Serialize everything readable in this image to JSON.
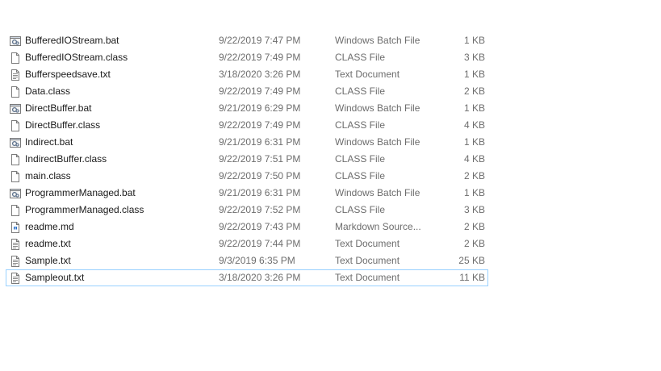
{
  "files": [
    {
      "name": "BufferedIOStream.bat",
      "date": "9/22/2019 7:47 PM",
      "type": "Windows Batch File",
      "size": "1 KB",
      "icon": "batch-file-icon"
    },
    {
      "name": "BufferedIOStream.class",
      "date": "9/22/2019 7:49 PM",
      "type": "CLASS File",
      "size": "3 KB",
      "icon": "generic-file-icon"
    },
    {
      "name": "Bufferspeedsave.txt",
      "date": "3/18/2020 3:26 PM",
      "type": "Text Document",
      "size": "1 KB",
      "icon": "text-file-icon"
    },
    {
      "name": "Data.class",
      "date": "9/22/2019 7:49 PM",
      "type": "CLASS File",
      "size": "2 KB",
      "icon": "generic-file-icon"
    },
    {
      "name": "DirectBuffer.bat",
      "date": "9/21/2019 6:29 PM",
      "type": "Windows Batch File",
      "size": "1 KB",
      "icon": "batch-file-icon"
    },
    {
      "name": "DirectBuffer.class",
      "date": "9/22/2019 7:49 PM",
      "type": "CLASS File",
      "size": "4 KB",
      "icon": "generic-file-icon"
    },
    {
      "name": "Indirect.bat",
      "date": "9/21/2019 6:31 PM",
      "type": "Windows Batch File",
      "size": "1 KB",
      "icon": "batch-file-icon"
    },
    {
      "name": "IndirectBuffer.class",
      "date": "9/22/2019 7:51 PM",
      "type": "CLASS File",
      "size": "4 KB",
      "icon": "generic-file-icon"
    },
    {
      "name": "main.class",
      "date": "9/22/2019 7:50 PM",
      "type": "CLASS File",
      "size": "2 KB",
      "icon": "generic-file-icon"
    },
    {
      "name": "ProgrammerManaged.bat",
      "date": "9/21/2019 6:31 PM",
      "type": "Windows Batch File",
      "size": "1 KB",
      "icon": "batch-file-icon"
    },
    {
      "name": "ProgrammerManaged.class",
      "date": "9/22/2019 7:52 PM",
      "type": "CLASS File",
      "size": "3 KB",
      "icon": "generic-file-icon"
    },
    {
      "name": "readme.md",
      "date": "9/22/2019 7:43 PM",
      "type": "Markdown Source...",
      "size": "2 KB",
      "icon": "markdown-file-icon"
    },
    {
      "name": "readme.txt",
      "date": "9/22/2019 7:44 PM",
      "type": "Text Document",
      "size": "2 KB",
      "icon": "text-file-icon"
    },
    {
      "name": "Sample.txt",
      "date": "9/3/2019 6:35 PM",
      "type": "Text Document",
      "size": "25 KB",
      "icon": "text-file-icon"
    },
    {
      "name": "Sampleout.txt",
      "date": "3/18/2020 3:26 PM",
      "type": "Text Document",
      "size": "11 KB",
      "icon": "text-file-icon",
      "selected": true
    }
  ],
  "colors": {
    "name_text": "#1a1a1a",
    "detail_text": "#6d6d6d",
    "selection_border": "#99d1ff"
  }
}
